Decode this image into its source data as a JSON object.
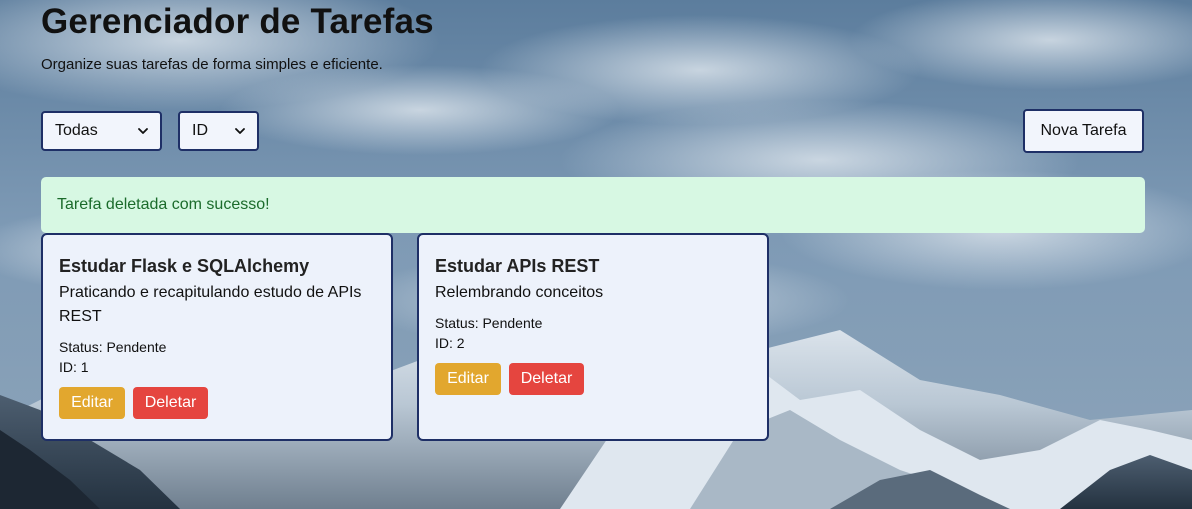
{
  "header": {
    "title": "Gerenciador de Tarefas",
    "subtitle": "Organize suas tarefas de forma simples e eficiente."
  },
  "controls": {
    "filter_selected": "Todas",
    "sort_selected": "ID",
    "new_task_label": "Nova Tarefa"
  },
  "alert": {
    "message": "Tarefa deletada com sucesso!"
  },
  "tasks": [
    {
      "title": "Estudar Flask e SQLAlchemy",
      "description": "Praticando e recapitulando estudo de APIs REST",
      "status": "Status: Pendente",
      "id": "ID: 1",
      "edit_label": "Editar",
      "delete_label": "Deletar"
    },
    {
      "title": "Estudar APIs REST",
      "description": "Relembrando conceitos",
      "status": "Status: Pendente",
      "id": "ID: 2",
      "edit_label": "Editar",
      "delete_label": "Deletar"
    }
  ],
  "colors": {
    "accent_border": "#1e2f66",
    "success_bg": "#d7f8e3",
    "success_text": "#1b6b2b",
    "edit_button": "#e2a72e",
    "delete_button": "#e5453f",
    "card_bg": "#edf2fb"
  },
  "icons": {
    "select_arrow": "chevron-down-icon",
    "background": "mountain-landscape"
  }
}
